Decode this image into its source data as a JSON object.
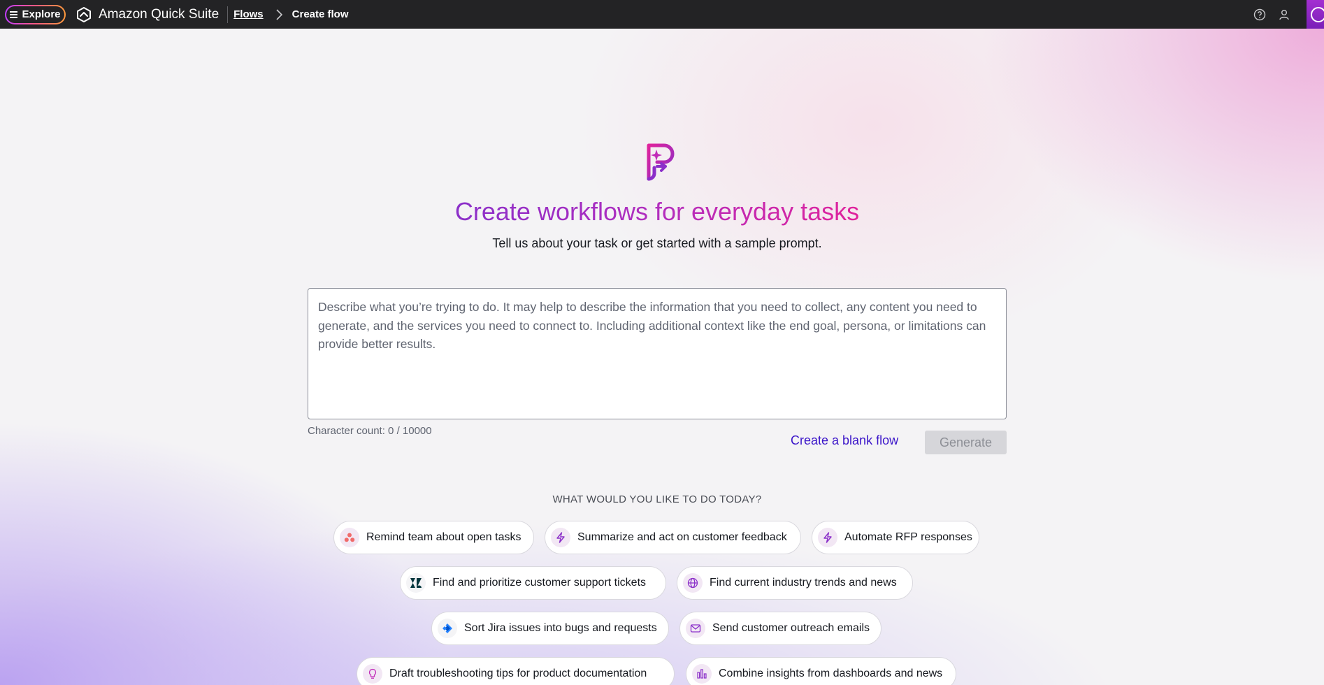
{
  "topbar": {
    "explore_label": "Explore",
    "app_name": "Amazon Quick Suite",
    "breadcrumb_parent": "Flows",
    "breadcrumb_current": "Create flow"
  },
  "hero": {
    "title": "Create workflows for everyday tasks",
    "subtitle": "Tell us about your task or get started with a sample prompt."
  },
  "prompt": {
    "value": "",
    "placeholder": "Describe what you’re trying to do. It may help to describe the information that you need to collect, any content you need to generate, and the services you need to connect to. Including additional context like the end goal, persona, or limitations can provide better results.",
    "char_count": "Character count: 0 / 10000"
  },
  "actions": {
    "blank_flow_label": "Create a blank flow",
    "generate_label": "Generate"
  },
  "suggestions": {
    "heading": "WHAT WOULD YOU LIKE TO DO TODAY?",
    "items": [
      {
        "label": "Remind team about open tasks",
        "icon": "asana-icon"
      },
      {
        "label": "Summarize and act on customer feedback",
        "icon": "bolt-icon"
      },
      {
        "label": "Automate RFP responses",
        "icon": "bolt-icon"
      },
      {
        "label": "Find and prioritize customer support tickets",
        "icon": "zendesk-icon"
      },
      {
        "label": "Find current industry trends and news",
        "icon": "globe-icon"
      },
      {
        "label": "Sort Jira issues into bugs and requests",
        "icon": "jira-icon"
      },
      {
        "label": "Send customer outreach emails",
        "icon": "mail-icon"
      },
      {
        "label": "Draft troubleshooting tips for product documentation",
        "icon": "lightbulb-icon"
      },
      {
        "label": "Combine insights from dashboards and news",
        "icon": "bar-chart-icon"
      }
    ]
  },
  "colors": {
    "topbar": "#232325",
    "link": "#3b15c9",
    "accent_purple": "#8b2fc9",
    "accent_pink": "#e0239c"
  }
}
